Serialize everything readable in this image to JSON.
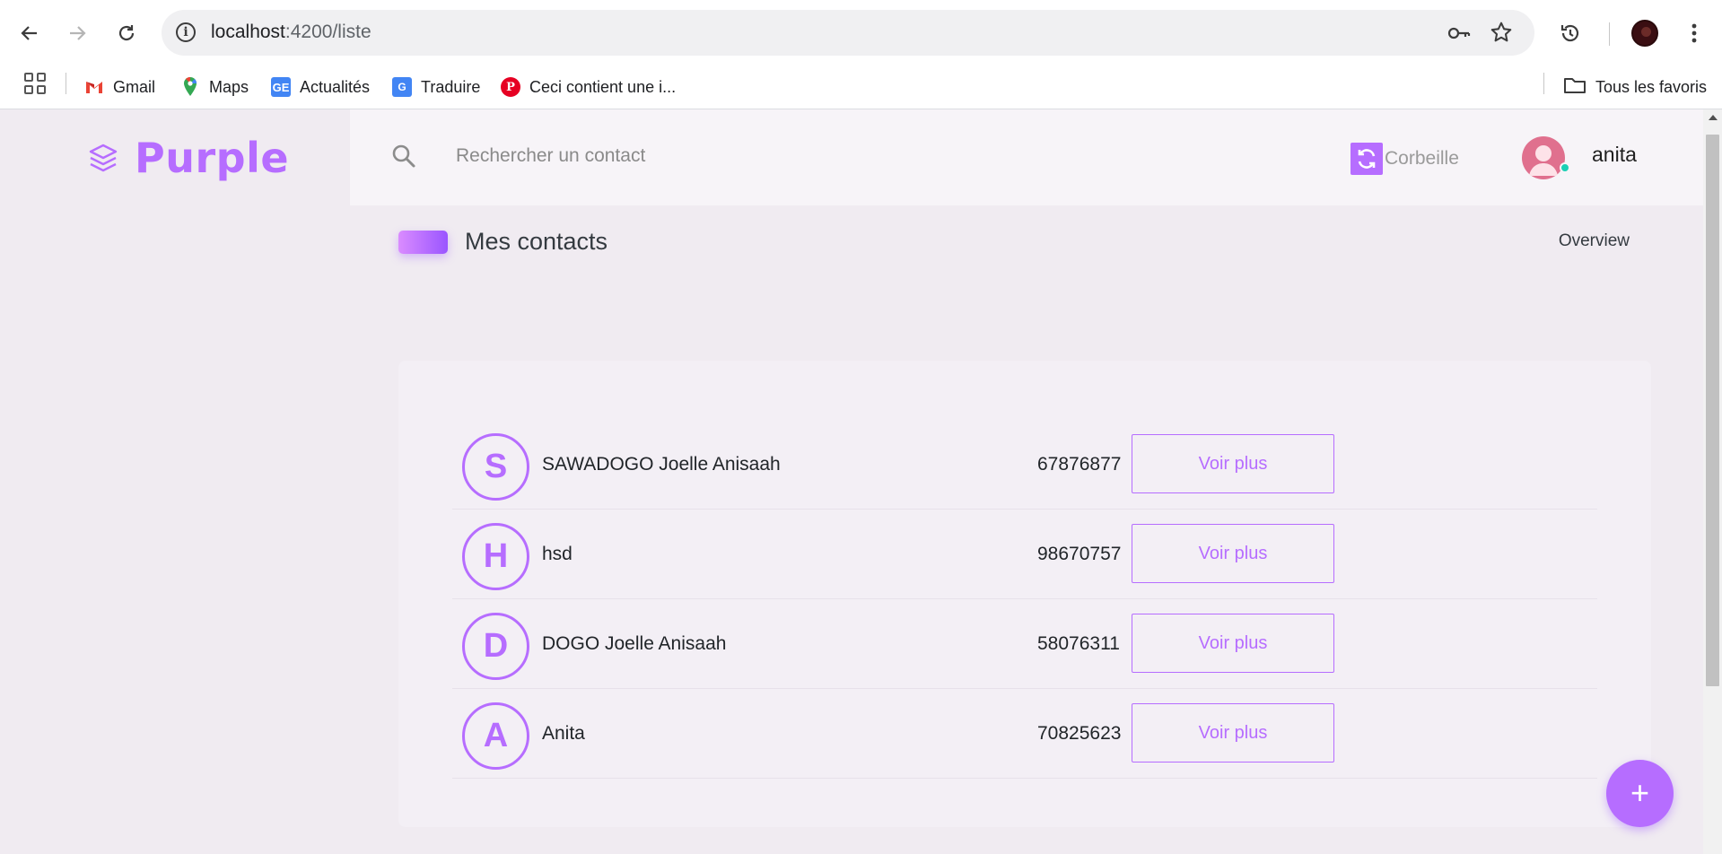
{
  "browser": {
    "url_host": "localhost",
    "url_path": ":4200/liste",
    "icons": [
      "back-icon",
      "forward-icon",
      "reload-icon",
      "site-info-icon",
      "password-key-icon",
      "bookmark-star-icon",
      "history-icon",
      "profile-avatar",
      "more-menu-icon"
    ],
    "bookmarks": [
      {
        "label": "Gmail",
        "icon": "gmail-icon",
        "color": "#ea4335"
      },
      {
        "label": "Maps",
        "icon": "maps-icon",
        "color": "#34a853"
      },
      {
        "label": "Actualités",
        "icon": "news-icon",
        "color": "#4285f4"
      },
      {
        "label": "Traduire",
        "icon": "translate-icon",
        "color": "#4285f4"
      },
      {
        "label": "Ceci contient une i...",
        "icon": "pinterest-icon",
        "color": "#e60023"
      }
    ],
    "all_bookmarks_label": "Tous les favoris"
  },
  "app": {
    "brand": "Purple",
    "search_placeholder": "Rechercher un contact",
    "trash_label": "Corbeille",
    "user_name": "anita",
    "page_title": "Mes contacts",
    "overview_label": "Overview",
    "accent_color": "#b66dff",
    "status_color": "#1bcfb4",
    "contacts": [
      {
        "initial": "S",
        "name": "SAWADOGO Joelle Anisaah",
        "phone": "67876877",
        "action": "Voir plus"
      },
      {
        "initial": "H",
        "name": "hsd",
        "phone": "98670757",
        "action": "Voir plus"
      },
      {
        "initial": "D",
        "name": "DOGO Joelle Anisaah",
        "phone": "58076311",
        "action": "Voir plus"
      },
      {
        "initial": "A",
        "name": "Anita",
        "phone": "70825623",
        "action": "Voir plus"
      }
    ],
    "fab_label": "+"
  }
}
